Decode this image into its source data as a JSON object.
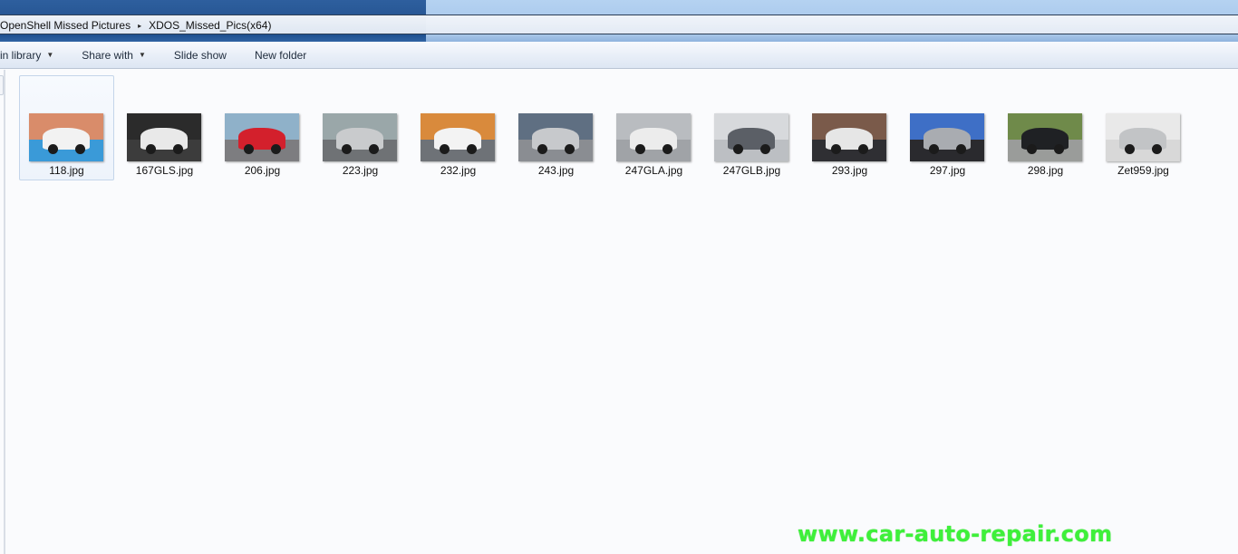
{
  "window": {
    "breadcrumb": [
      {
        "label": "OpenShell Missed Pictures"
      },
      {
        "label": "XDOS_Missed_Pics(x64)"
      }
    ],
    "breadcrumb_separator": "▸"
  },
  "toolbar": {
    "include_label": "in library",
    "share_label": "Share with",
    "slideshow_label": "Slide show",
    "newfolder_label": "New folder",
    "caret": "▼"
  },
  "files": [
    {
      "name": "118.jpg",
      "selected": true,
      "sky": "#d98c6a",
      "ground": "#3a9ad8",
      "car": "#f2f2f2"
    },
    {
      "name": "167GLS.jpg",
      "selected": false,
      "sky": "#2b2b2b",
      "ground": "#3c3c3c",
      "car": "#e9e9e9"
    },
    {
      "name": "206.jpg",
      "selected": false,
      "sky": "#8fb1c9",
      "ground": "#7d7d80",
      "car": "#d3202c"
    },
    {
      "name": "223.jpg",
      "selected": false,
      "sky": "#9aa7a9",
      "ground": "#6f7275",
      "car": "#c9cbcd"
    },
    {
      "name": "232.jpg",
      "selected": false,
      "sky": "#d98a3c",
      "ground": "#6e7277",
      "car": "#f3f3f3"
    },
    {
      "name": "243.jpg",
      "selected": false,
      "sky": "#5f6f82",
      "ground": "#8a8d92",
      "car": "#c7c9cc"
    },
    {
      "name": "247GLA.jpg",
      "selected": false,
      "sky": "#b9bcc0",
      "ground": "#a0a3a7",
      "car": "#ececec"
    },
    {
      "name": "247GLB.jpg",
      "selected": false,
      "sky": "#d7d9dc",
      "ground": "#bcbfc3",
      "car": "#5b5f66"
    },
    {
      "name": "293.jpg",
      "selected": false,
      "sky": "#7a5a4a",
      "ground": "#2f2f33",
      "car": "#e6e6e6"
    },
    {
      "name": "297.jpg",
      "selected": false,
      "sky": "#3e6fc6",
      "ground": "#2a2a2e",
      "car": "#a9acb1"
    },
    {
      "name": "298.jpg",
      "selected": false,
      "sky": "#6f8a4a",
      "ground": "#9a9c9a",
      "car": "#1f2124"
    },
    {
      "name": "Zet959.jpg",
      "selected": false,
      "sky": "#e9e9e9",
      "ground": "#d8d8d8",
      "car": "#c2c4c6"
    }
  ],
  "watermark": "www.car-auto-repair.com"
}
